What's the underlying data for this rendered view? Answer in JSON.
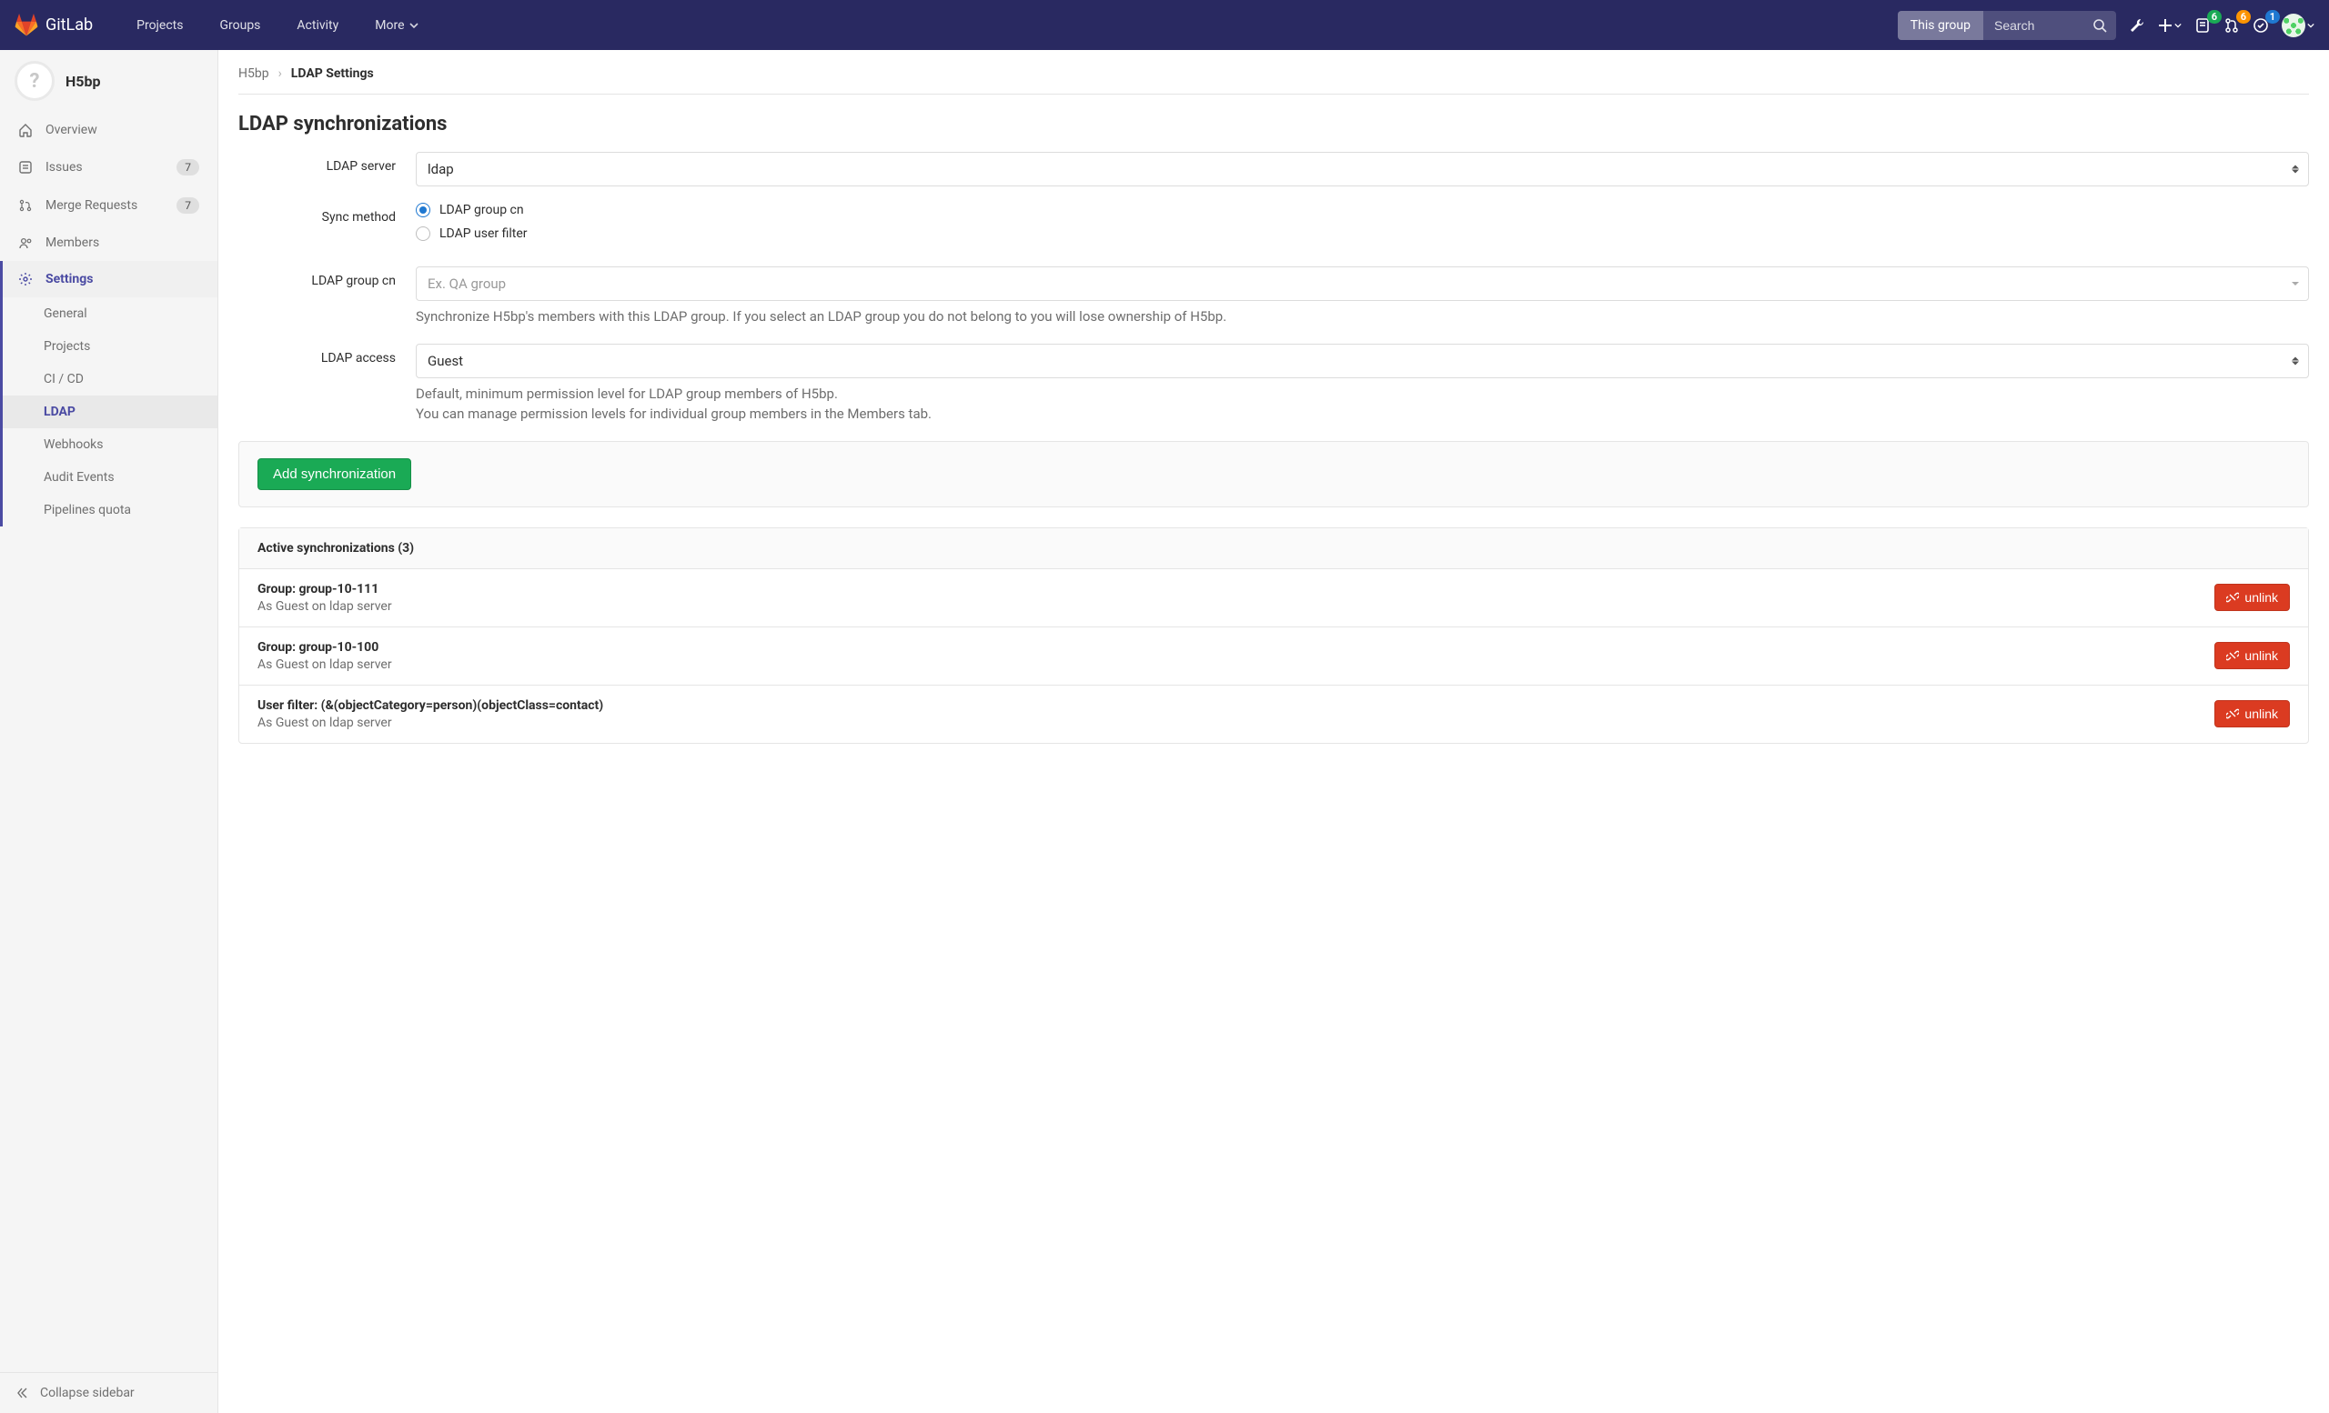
{
  "brand": "GitLab",
  "nav": {
    "projects": "Projects",
    "groups": "Groups",
    "activity": "Activity",
    "more": "More"
  },
  "search": {
    "scope": "This group",
    "placeholder": "Search"
  },
  "topbar_badges": {
    "issues": "6",
    "mrs": "6",
    "todos": "1"
  },
  "sidebar": {
    "group_avatar_letter": "?",
    "group_name": "H5bp",
    "items": [
      {
        "label": "Overview"
      },
      {
        "label": "Issues",
        "count": "7"
      },
      {
        "label": "Merge Requests",
        "count": "7"
      },
      {
        "label": "Members"
      },
      {
        "label": "Settings"
      }
    ],
    "settings_sub": [
      {
        "label": "General"
      },
      {
        "label": "Projects"
      },
      {
        "label": "CI / CD"
      },
      {
        "label": "LDAP"
      },
      {
        "label": "Webhooks"
      },
      {
        "label": "Audit Events"
      },
      {
        "label": "Pipelines quota"
      }
    ],
    "collapse": "Collapse sidebar"
  },
  "breadcrumbs": {
    "root": "H5bp",
    "current": "LDAP Settings"
  },
  "page": {
    "title": "LDAP synchronizations",
    "labels": {
      "ldap_server": "LDAP server",
      "sync_method": "Sync method",
      "ldap_group_cn": "LDAP group cn",
      "ldap_access": "LDAP access"
    },
    "values": {
      "ldap_server": "ldap",
      "ldap_access": "Guest"
    },
    "radios": {
      "group_cn": "LDAP group cn",
      "user_filter": "LDAP user filter"
    },
    "placeholders": {
      "group_cn": "Ex. QA group"
    },
    "help": {
      "group_cn": "Synchronize H5bp's members with this LDAP group. If you select an LDAP group you do not belong to you will lose ownership of H5bp.",
      "access_l1": "Default, minimum permission level for LDAP group members of H5bp.",
      "access_l2": "You can manage permission levels for individual group members in the Members tab."
    },
    "add_button": "Add synchronization"
  },
  "active_panel": {
    "header": "Active synchronizations (3)",
    "rows": [
      {
        "title": "Group: group-10-111",
        "sub": "As Guest on ldap server"
      },
      {
        "title": "Group: group-10-100",
        "sub": "As Guest on ldap server"
      },
      {
        "title": "User filter: (&(objectCategory=person)(objectClass=contact)",
        "sub": "As Guest on ldap server"
      }
    ],
    "unlink_label": "unlink"
  }
}
